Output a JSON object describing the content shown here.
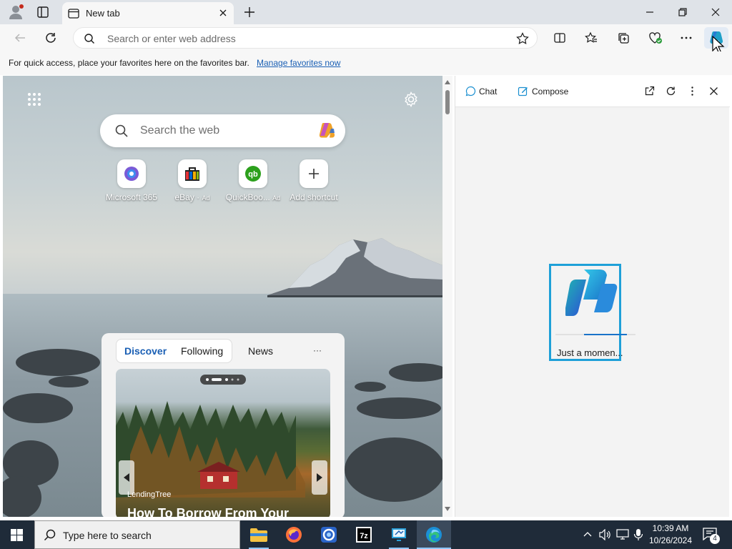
{
  "tab": {
    "title": "New tab"
  },
  "address_bar": {
    "placeholder": "Search or enter web address"
  },
  "favorites_bar": {
    "message": "For quick access, place your favorites here on the favorites bar.",
    "link": "Manage favorites now"
  },
  "new_tab_page": {
    "search_placeholder": "Search the web",
    "shortcuts": [
      {
        "label": "Microsoft 365",
        "ad": ""
      },
      {
        "label": "eBay",
        "ad": "Ad"
      },
      {
        "label": "QuickBoo...",
        "ad": "Ad"
      },
      {
        "label": "Add shortcut",
        "ad": ""
      }
    ],
    "feed_tabs": [
      "Discover",
      "Following",
      "News"
    ],
    "feed_more": "···",
    "card": {
      "source": "LendingTree",
      "headline": "How To Borrow From Your"
    }
  },
  "copilot": {
    "chat_label": "Chat",
    "compose_label": "Compose",
    "loading_text": "Just a momen..."
  },
  "taskbar": {
    "search_placeholder": "Type here to search",
    "time": "10:39 AM",
    "date": "10/26/2024",
    "notification_count": "4"
  }
}
